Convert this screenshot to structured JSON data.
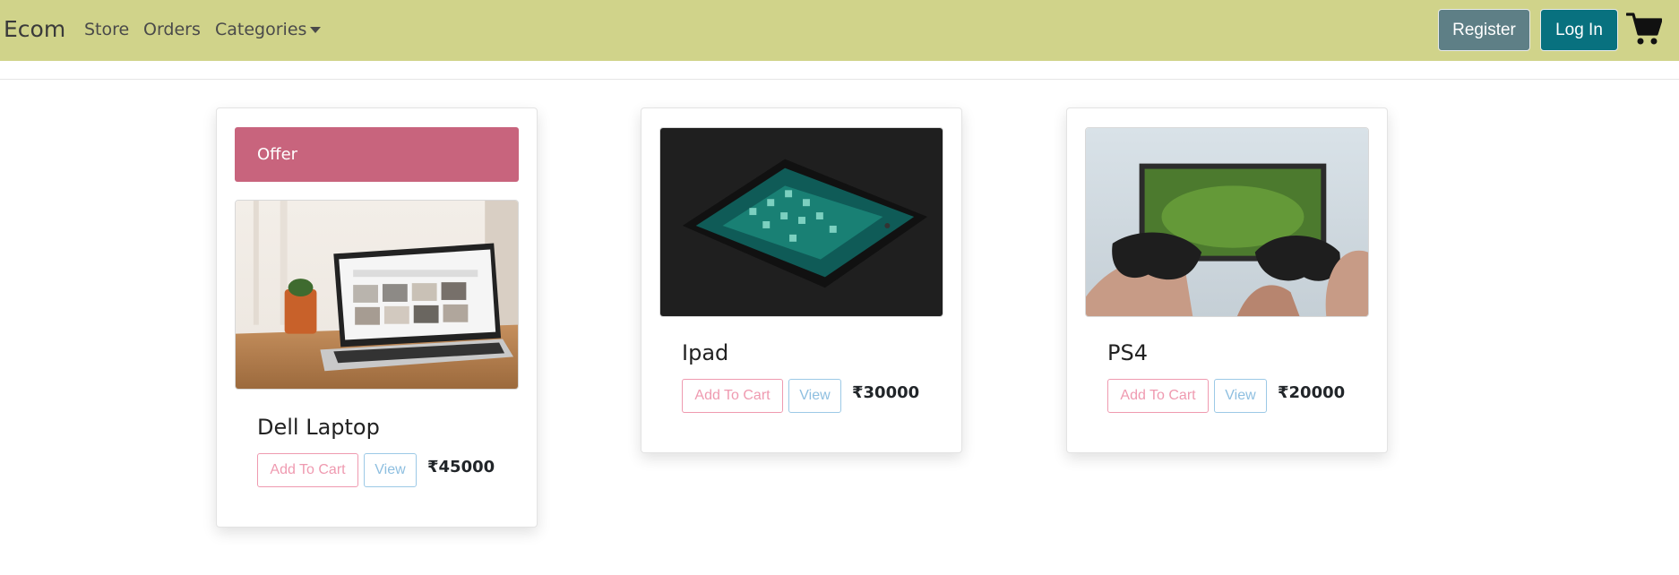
{
  "navbar": {
    "brand": "Ecom",
    "links": [
      "Store",
      "Orders",
      "Categories"
    ],
    "register_label": "Register",
    "login_label": "Log In",
    "cart_icon": "shopping-cart-icon"
  },
  "colors": {
    "navbar_bg": "#d0d38a",
    "register_bg": "#5e7f86",
    "login_bg": "#08717f",
    "offer_bg": "#c8647d",
    "add_to_cart": "#ef9ab0",
    "view": "#8ebfe0"
  },
  "products": [
    {
      "badge": "Offer",
      "name": "Dell Laptop",
      "add_to_cart_label": "Add To Cart",
      "view_label": "View",
      "price": "₹45000",
      "image": "laptop-photo"
    },
    {
      "name": "Ipad",
      "add_to_cart_label": "Add To Cart",
      "view_label": "View",
      "price": "₹30000",
      "image": "tablet-photo"
    },
    {
      "name": "PS4",
      "add_to_cart_label": "Add To Cart",
      "view_label": "View",
      "price": "₹20000",
      "image": "game-controller-photo"
    }
  ]
}
